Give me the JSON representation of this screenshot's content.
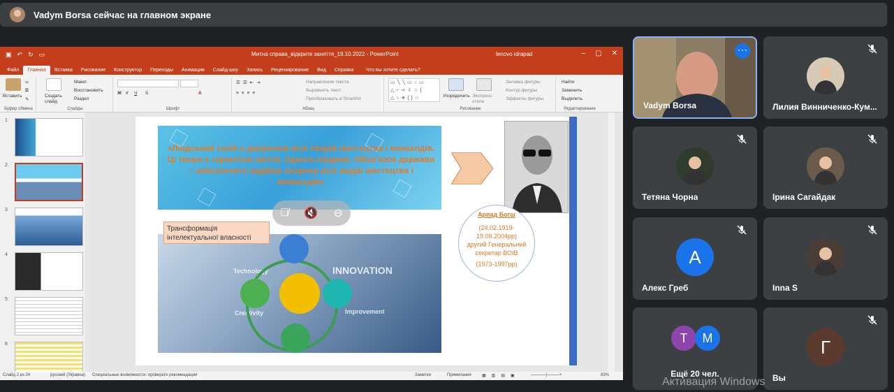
{
  "banner": {
    "text": "Vadym Borsa сейчас на главном экране"
  },
  "ppt": {
    "doc_title": "Митна справа_відкрите заняття_19.10.2022 - PowerPoint",
    "user": "lenovo idrapad",
    "tabs": [
      "Файл",
      "Главная",
      "Вставка",
      "Рисование",
      "Конструктор",
      "Переходы",
      "Анимация",
      "Слайд-шоу",
      "Запись",
      "Рецензирование",
      "Вид",
      "Справка"
    ],
    "active_tab": "Главная",
    "tell_me": "Что вы хотите сделать?",
    "ribbon": {
      "paste": "Вставить",
      "create_slide": "Создать слайд",
      "layout": "Макет",
      "reset": "Восстановить",
      "section": "Раздел",
      "text_direction": "Направление текста",
      "align_text": "Выровнять текст",
      "smartart": "Преобразовать в SmartArt",
      "arrange": "Упорядочить",
      "quick_styles": "Экспресс-стили",
      "fill": "Заливка фигуры",
      "outline": "Контур фигуры",
      "effects": "Эффекты фигуры",
      "find": "Найти",
      "replace": "Заменить",
      "select": "Выделить",
      "groups": [
        "Буфер обмена",
        "Слайды",
        "Шрифт",
        "Абзац",
        "Рисование",
        "Редактирование"
      ]
    },
    "thumb_numbers": [
      "1",
      "2",
      "3",
      "4",
      "5",
      "6"
    ],
    "slide": {
      "quote": "«Людський геній є джерелом всіх творів мистецтва і винаходів. Ці твори є гарантією життя, гідного людини. Обов'язок держави – забезпечити надійну охорону всіх видів мистецтва і винаходів»",
      "caption_name": "Арпад Богш",
      "caption_dates": "(24.02.1919-\n19.09.2004рр)\nдругий Генеральний\nсекретар ВОІВ",
      "caption_years": "(1973-1997рр)",
      "transf_label": "Трансформація інтелектуальної власності",
      "innov_words": [
        "INNOVATION",
        "Technology",
        "Creativity",
        "Improvement"
      ]
    },
    "status": {
      "slide_num": "Слайд 2 из 24",
      "lang": "русский (Украина)",
      "access": "Специальные возможности: проверьте рекомендации",
      "notes": "Заметки",
      "comments": "Примечания",
      "zoom": "83%"
    }
  },
  "participants": [
    {
      "name": "Vadym Borsa",
      "kind": "video",
      "active": true
    },
    {
      "name": "Лилия Винниченко-Кум...",
      "kind": "photo",
      "muted": true
    },
    {
      "name": "Тетяна Чорна",
      "kind": "photo",
      "muted": true
    },
    {
      "name": "Ірина Сагайдак",
      "kind": "photo",
      "muted": true
    },
    {
      "name": "Алекс Греб",
      "kind": "letter",
      "letter": "А",
      "color": "#1a73e8",
      "muted": true
    },
    {
      "name": "Inna S",
      "kind": "photo",
      "muted": true
    },
    {
      "name": "Ещё 20 чел.",
      "kind": "group",
      "letters": [
        "Т",
        "М"
      ],
      "colors": [
        "#8e44ad",
        "#1a73e8"
      ]
    },
    {
      "name": "Вы",
      "kind": "letter",
      "letter": "Г",
      "color": "#5d3a2e",
      "muted": true
    }
  ],
  "activation": "Активация Windows"
}
